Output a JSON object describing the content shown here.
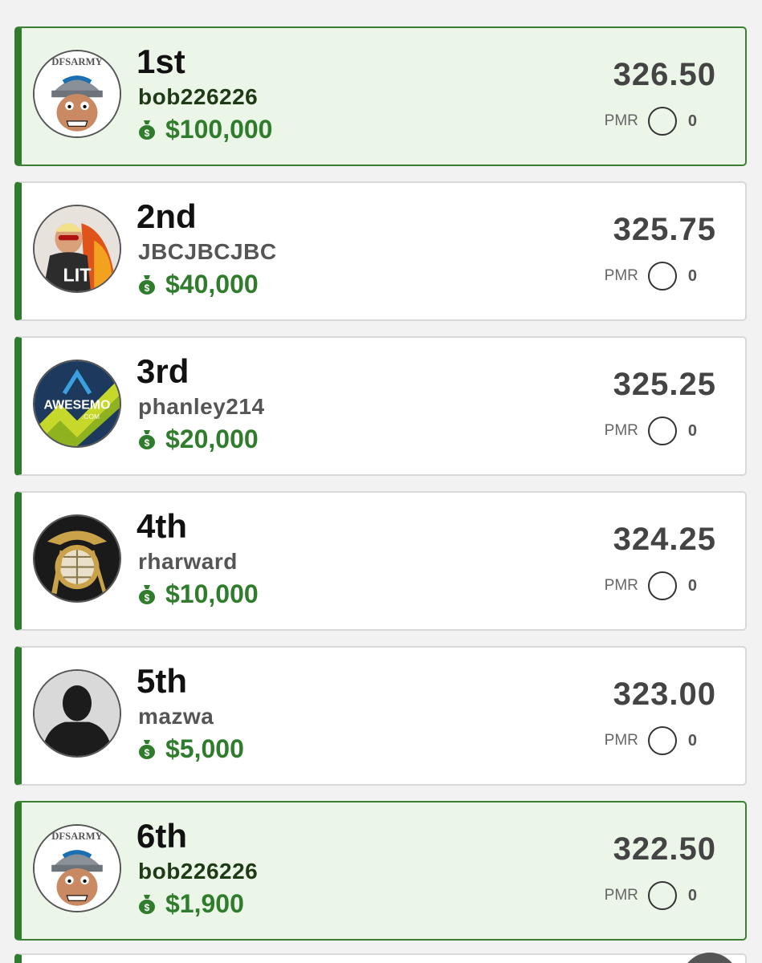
{
  "colors": {
    "accent_green": "#2f7d2c",
    "highlight_bg": "#ebf6e8",
    "card_bg": "#ffffff",
    "page_bg": "#f2f2f2"
  },
  "entries": [
    {
      "rank": "1st",
      "username": "bob226226",
      "prize": "$100,000",
      "score": "326.50",
      "pmr_label": "PMR",
      "pmr_value": "0",
      "avatar": "dfsarmy-logo",
      "highlight": true
    },
    {
      "rank": "2nd",
      "username": "JBCJBCJBC",
      "prize": "$40,000",
      "score": "325.75",
      "pmr_label": "PMR",
      "pmr_value": "0",
      "avatar": "lit-photo",
      "highlight": false
    },
    {
      "rank": "3rd",
      "username": "phanley214",
      "prize": "$20,000",
      "score": "325.25",
      "pmr_label": "PMR",
      "pmr_value": "0",
      "avatar": "awesemo-logo",
      "highlight": false
    },
    {
      "rank": "4th",
      "username": "rharward",
      "prize": "$10,000",
      "score": "324.25",
      "pmr_label": "PMR",
      "pmr_value": "0",
      "avatar": "marine-emblem",
      "highlight": false
    },
    {
      "rank": "5th",
      "username": "mazwa",
      "prize": "$5,000",
      "score": "323.00",
      "pmr_label": "PMR",
      "pmr_value": "0",
      "avatar": "default-silhouette",
      "highlight": false
    },
    {
      "rank": "6th",
      "username": "bob226226",
      "prize": "$1,900",
      "score": "322.50",
      "pmr_label": "PMR",
      "pmr_value": "0",
      "avatar": "dfsarmy-logo",
      "highlight": true
    }
  ]
}
